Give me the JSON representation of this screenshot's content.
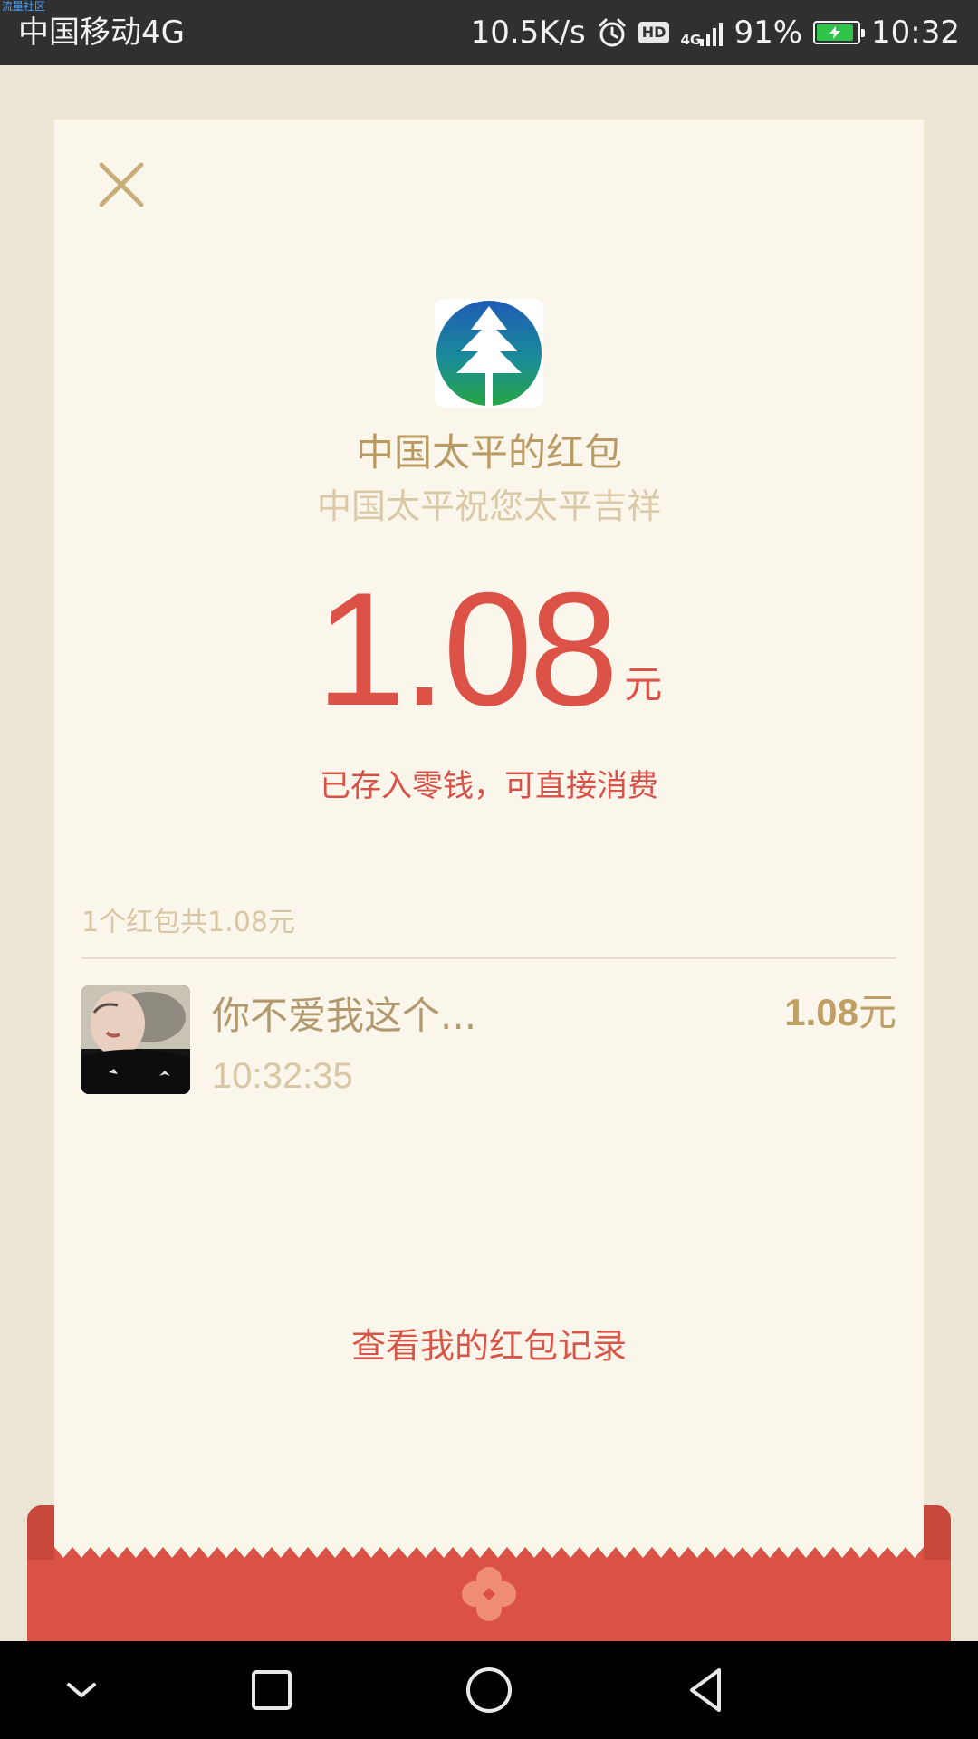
{
  "status_bar": {
    "watermark": "流量社区",
    "carrier": "中国移动4G",
    "net_speed": "10.5K/s",
    "hd_badge": "HD",
    "network_type": "4G",
    "battery_percent": "91%",
    "time": "10:32",
    "icons": [
      "alarm-icon",
      "signal-icon",
      "battery-charging-icon"
    ]
  },
  "envelope": {
    "sender_title": "中国太平的红包",
    "blessing": "中国太平祝您太平吉祥",
    "amount": "1.08",
    "amount_unit": "元",
    "stored_note": "已存入零钱，可直接消费",
    "summary": "1个红包共1.08元",
    "records": [
      {
        "name": "你不爱我这个...",
        "time": "10:32:35",
        "amount": "1.08",
        "amount_unit": "元"
      }
    ],
    "history_link": "查看我的红包记录"
  },
  "colors": {
    "accent_red": "#dc5246",
    "gold_text": "#b99a62",
    "paper": "#faf6ec",
    "background": "#ece6d6"
  },
  "nav_bar": {
    "icons": [
      "chevron-down-icon",
      "recents-square-icon",
      "home-circle-icon",
      "back-triangle-icon"
    ]
  }
}
